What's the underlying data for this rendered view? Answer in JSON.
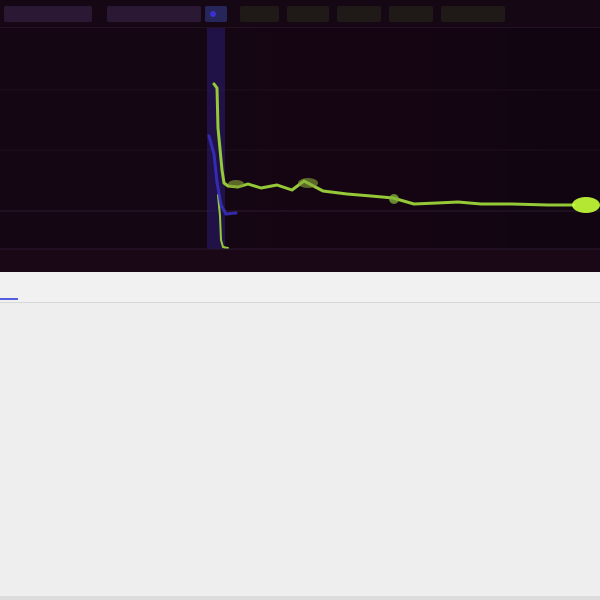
{
  "chart": {
    "toolbar": {
      "left_items": [
        "",
        "",
        ""
      ],
      "right_items": [
        "",
        "",
        "",
        "",
        ""
      ]
    },
    "x_ticks": [
      "",
      "",
      "",
      "",
      "",
      "",
      ""
    ],
    "colors": {
      "background": "#130510",
      "series_primary": "#a6e138",
      "series_secondary": "#2f2ca8",
      "current_marker": "#c6ff38"
    }
  },
  "tabs": [
    {
      "label": ""
    },
    {
      "label": ""
    },
    {
      "label": ""
    },
    {
      "label": ""
    },
    {
      "label": ""
    }
  ],
  "details": [
    {
      "label": "",
      "value": ""
    },
    {
      "label": "",
      "value": ""
    },
    {
      "label": "",
      "value_primary": "",
      "value_secondary": ""
    },
    {
      "label": "",
      "value": ""
    },
    {
      "label": "",
      "value": ""
    },
    {
      "label": "",
      "value": ""
    },
    {
      "label": "",
      "value": ""
    },
    {
      "label": "",
      "line1": "",
      "line2": ""
    },
    {
      "label": "",
      "line1": "",
      "line2": ""
    }
  ]
}
